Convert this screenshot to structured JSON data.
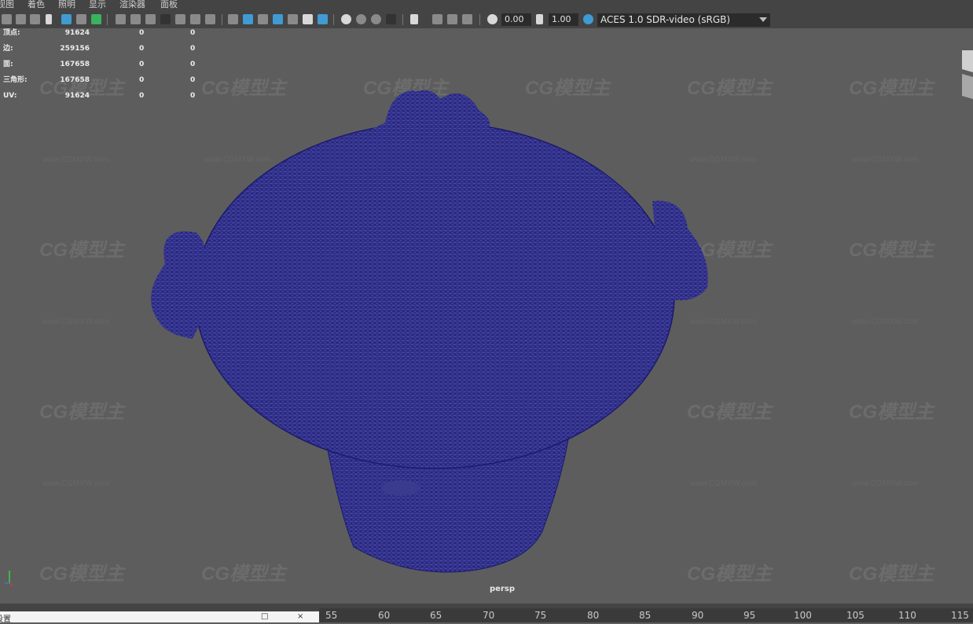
{
  "menu": [
    "视图",
    "着色",
    "照明",
    "显示",
    "渲染器",
    "面板"
  ],
  "toolbar": {
    "exposure_value": "0.00",
    "gamma_value": "1.00",
    "color_space": "ACES 1.0 SDR-video (sRGB)",
    "icons": [
      "camera-icon",
      "camera-attr-icon",
      "bookmark-icon",
      "image-plane-icon",
      "grid-icon",
      "pan-zoom-icon",
      "pencil-icon",
      "grid-toggle-icon",
      "film-gate-icon",
      "resolution-gate-icon",
      "gate-mask-icon",
      "field-chart-icon",
      "safe-action-icon",
      "safe-title-icon",
      "wireframe-icon",
      "smooth-shade-icon",
      "default-lighting-icon",
      "texture-icon",
      "lights-icon",
      "shadows-icon",
      "ambient-occlusion-icon",
      "motion-blur-icon",
      "anti-alias-icon",
      "depth-of-field-icon",
      "isolate-select-icon",
      "xray-icon",
      "xray-joints-icon",
      "backface-icon",
      "exposure-icon",
      "gamma-icon",
      "color-mgmt-icon"
    ]
  },
  "hud": {
    "rows": [
      {
        "label": "顶点:",
        "v1": "91624",
        "v2": "0",
        "v3": "0"
      },
      {
        "label": "边:",
        "v1": "259156",
        "v2": "0",
        "v3": "0"
      },
      {
        "label": "面:",
        "v1": "167658",
        "v2": "0",
        "v3": "0"
      },
      {
        "label": "三角形:",
        "v1": "167658",
        "v2": "0",
        "v3": "0"
      },
      {
        "label": "UV:",
        "v1": "91624",
        "v2": "0",
        "v3": "0"
      }
    ]
  },
  "watermark": {
    "logo": "CG模型主",
    "url": "www.CGMXW.com"
  },
  "camera": "persp",
  "timeline": {
    "ticks": [
      "55",
      "60",
      "65",
      "70",
      "75",
      "80",
      "85",
      "90",
      "95",
      "100",
      "105",
      "110",
      "115"
    ]
  },
  "window_fragment": {
    "title": "设置",
    "max_icon": "□",
    "close_icon": "×"
  },
  "colors": {
    "wireframe": "#1a1a7a",
    "viewport_bg": "#5d5d5d"
  }
}
